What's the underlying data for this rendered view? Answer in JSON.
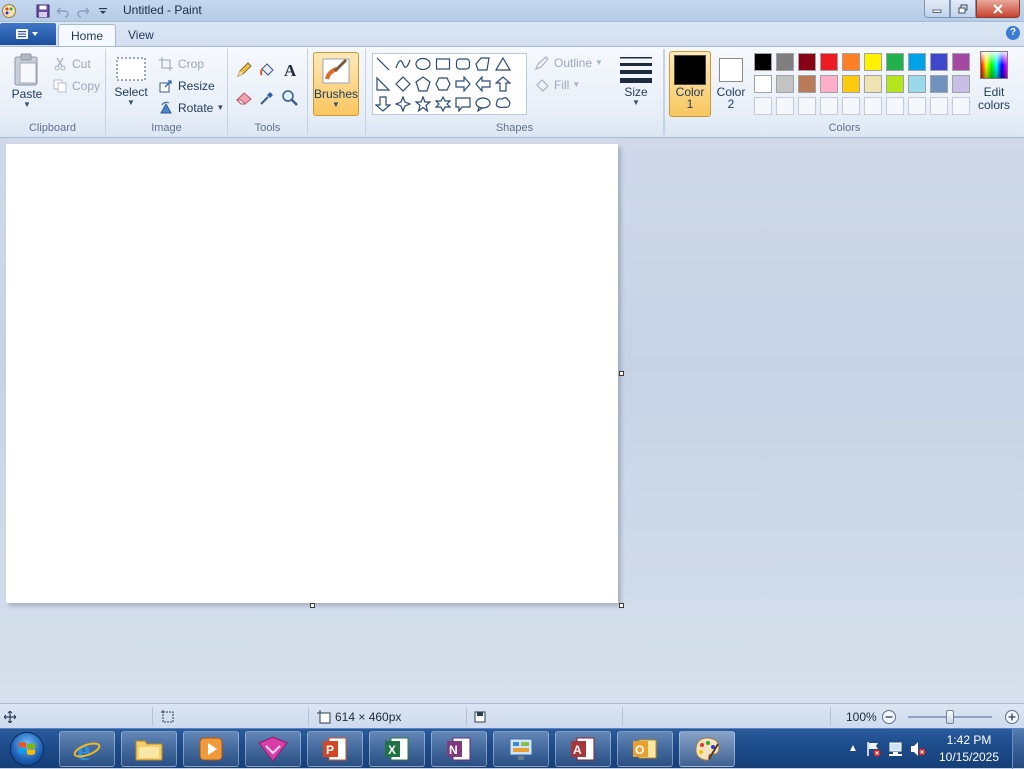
{
  "window": {
    "title": "Untitled - Paint"
  },
  "tabs": [
    {
      "label": "Home"
    },
    {
      "label": "View"
    }
  ],
  "ribbon": {
    "clipboard": {
      "label": "Clipboard",
      "paste": "Paste",
      "cut": "Cut",
      "copy": "Copy"
    },
    "image": {
      "label": "Image",
      "select": "Select",
      "crop": "Crop",
      "resize": "Resize",
      "rotate": "Rotate"
    },
    "tools": {
      "label": "Tools"
    },
    "brushes": {
      "label": "Brushes"
    },
    "shapes": {
      "label": "Shapes",
      "outline": "Outline",
      "fill": "Fill"
    },
    "size": {
      "label": "Size"
    },
    "colors": {
      "label": "Colors",
      "color1_line1": "Color",
      "color1_line2": "1",
      "color2_line1": "Color",
      "color2_line2": "2",
      "edit_line1": "Edit",
      "edit_line2": "colors",
      "color1": "#000000",
      "color2": "#ffffff",
      "palette_row1": [
        "#000000",
        "#7f7f7f",
        "#880015",
        "#ed1c24",
        "#ff7f27",
        "#fff200",
        "#22b14c",
        "#00a2e8",
        "#3f48cc",
        "#a349a4"
      ],
      "palette_row2": [
        "#ffffff",
        "#c3c3c3",
        "#b97a57",
        "#ffaec9",
        "#ffc90e",
        "#efe4b0",
        "#b5e61d",
        "#99d9ea",
        "#7092be",
        "#c8bfe7"
      ]
    }
  },
  "statusbar": {
    "size": "614 × 460px",
    "zoom": "100%"
  },
  "taskbar": {
    "time": "1:42 PM",
    "date": "10/15/2025"
  }
}
